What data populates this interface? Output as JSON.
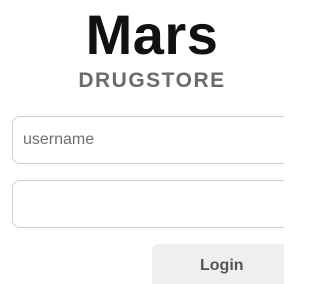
{
  "brand": {
    "title": "Mars",
    "subtitle": "DRUGSTORE"
  },
  "form": {
    "username": {
      "placeholder": "username",
      "value": ""
    },
    "password": {
      "placeholder": "",
      "value": ""
    },
    "login_label": "Login"
  }
}
